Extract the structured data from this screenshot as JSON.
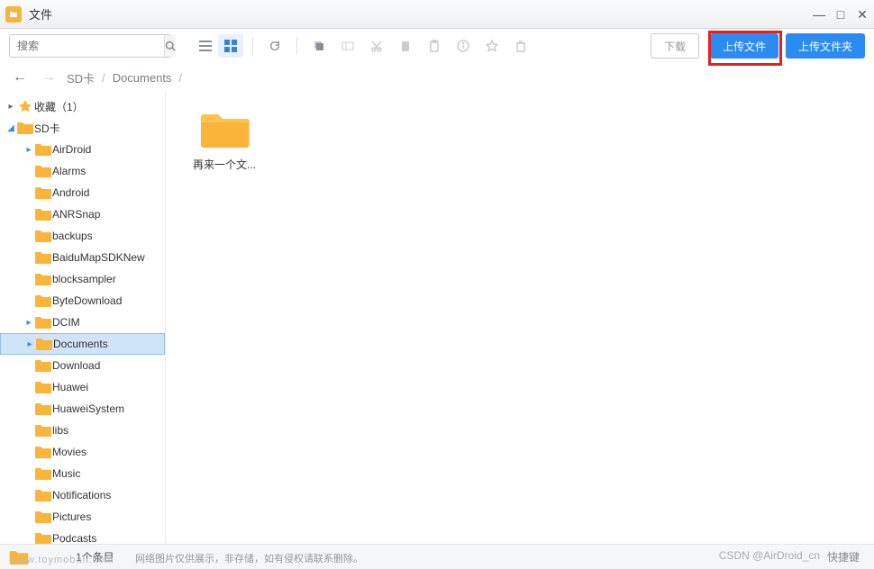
{
  "window": {
    "title": "文件"
  },
  "search": {
    "placeholder": "搜索"
  },
  "toolbar": {
    "download_label": "下载",
    "upload_file_label": "上传文件",
    "upload_folder_label": "上传文件夹"
  },
  "breadcrumb": {
    "items": [
      "SD卡",
      "Documents"
    ]
  },
  "sidebar": {
    "favorites_label": "收藏（1）",
    "root_label": "SD卡",
    "folders": [
      "AirDroid",
      "Alarms",
      "Android",
      "ANRSnap",
      "backups",
      "BaiduMapSDKNew",
      "blocksampler",
      "ByteDownload",
      "DCIM",
      "Documents",
      "Download",
      "Huawei",
      "HuaweiSystem",
      "libs",
      "Movies",
      "Music",
      "Notifications",
      "Pictures",
      "Podcasts"
    ],
    "selected": "Documents",
    "expandable": [
      "AirDroid",
      "DCIM",
      "Documents"
    ]
  },
  "content": {
    "items": [
      {
        "name": "再来一个文..."
      }
    ]
  },
  "statusbar": {
    "count_label": "1个条目",
    "shortcut_label": "快捷键"
  },
  "watermarks": {
    "left": "www.toymoban.com",
    "mid": "网络图片仅供展示，非存储，如有侵权请联系删除。",
    "right": "CSDN @AirDroid_cn"
  }
}
